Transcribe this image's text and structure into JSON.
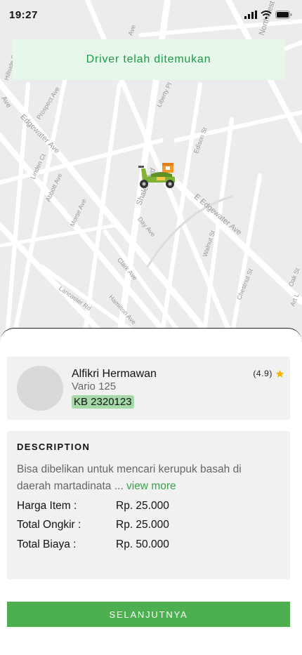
{
  "status_bar": {
    "time": "19:27"
  },
  "map": {
    "street_labels": [
      "Ave",
      "Edgewater Ave",
      "Prospect Ave",
      "Liberty Pl",
      "Edison St",
      "Linden Ct",
      "Abbott Ave",
      "Morse Ave",
      "Shaler Blvd",
      "Day Ave",
      "E Edgewater Ave",
      "Walnut St",
      "Clark Ave",
      "Lancaster Rd",
      "Hamilton Ave",
      "Chestnut St",
      "Oak St",
      "Art L",
      "Hillside St",
      "Ave",
      "Northcrest"
    ],
    "vehicle_icon": "scooter-delivery-icon"
  },
  "banner": {
    "text": "Driver telah ditemukan"
  },
  "driver": {
    "name": "Alfikri Hermawan",
    "vehicle": "Vario 125",
    "plate": "KB 2320123",
    "rating": "(4.9)",
    "rating_icon": "star-icon"
  },
  "description": {
    "title": "DESCRIPTION",
    "text": "Bisa dibelikan untuk mencari kerupuk basah di daerah martadinata ...",
    "view_more": "view more",
    "rows": [
      {
        "label": "Harga Item  :",
        "value": "Rp. 25.000"
      },
      {
        "label": "Total Ongkir :",
        "value": "Rp. 25.000"
      },
      {
        "label": "Total Biaya   :",
        "value": "Rp. 50.000"
      }
    ]
  },
  "actions": {
    "next_label": "SELANJUTNYA"
  },
  "colors": {
    "accent": "#4caf50",
    "banner_bg": "#e7f7ea",
    "banner_text": "#1b9b48",
    "plate_bg": "#a6d9a8",
    "star": "#f5b400"
  }
}
